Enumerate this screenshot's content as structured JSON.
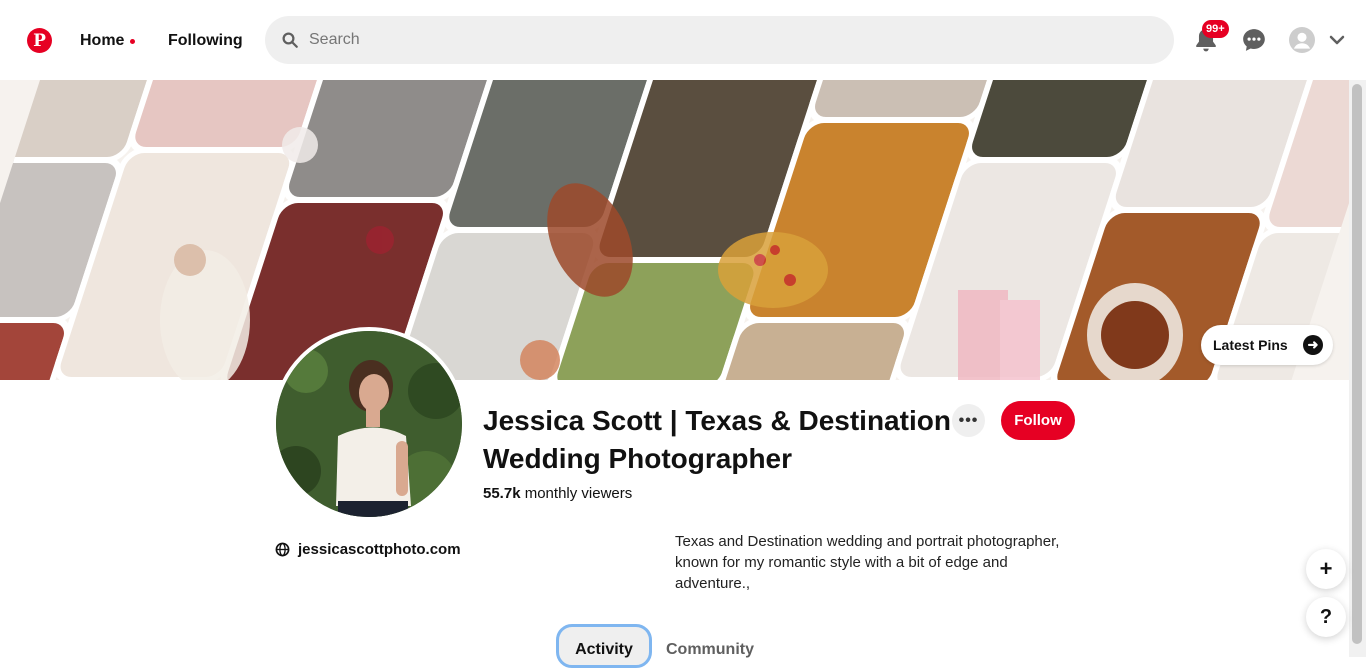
{
  "header": {
    "logo_letter": "P",
    "home_label": "Home",
    "following_label": "Following",
    "search_placeholder": "Search",
    "notifications_badge": "99+",
    "icons": [
      "pinterest-logo",
      "search-icon",
      "bell-icon",
      "chat-icon",
      "account-icon",
      "chevron-down-icon"
    ]
  },
  "cover": {
    "latest_pins_label": "Latest Pins"
  },
  "profile": {
    "name": "Jessica Scott | Texas & Destination Wedding Photographer",
    "more_label": "•••",
    "follow_label": "Follow",
    "viewers_count": "55.7k",
    "viewers_label": "monthly viewers",
    "website": "jessicascottphoto.com",
    "bio": "Texas and Destination wedding and portrait photographer, known for my romantic style with a bit of edge and adventure.,"
  },
  "tabs": [
    {
      "label": "Activity",
      "active": true
    },
    {
      "label": "Community",
      "active": false
    }
  ],
  "floating": {
    "plus_label": "+",
    "help_label": "?"
  },
  "colors": {
    "brand": "#e60023",
    "search_bg": "#efefef",
    "tab_focus": "#7fb6f0"
  }
}
